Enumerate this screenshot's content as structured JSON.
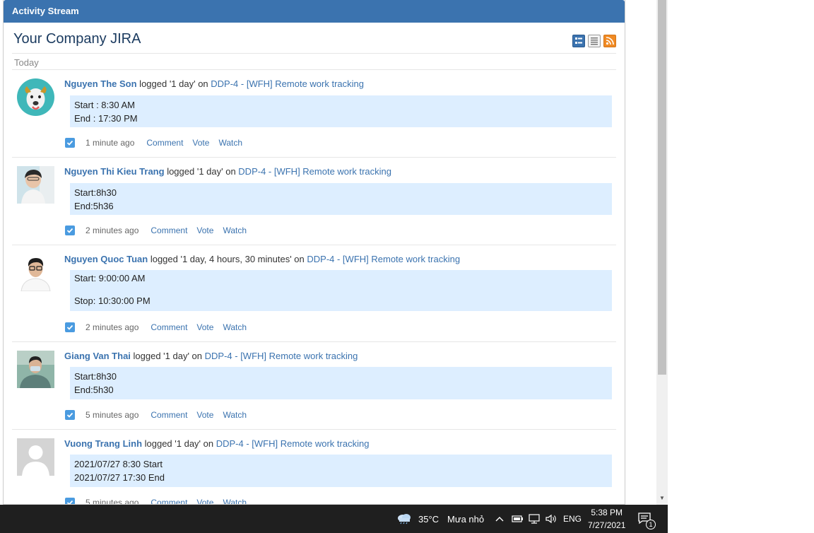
{
  "gadget": {
    "header": "Activity Stream",
    "title": "Your Company JIRA",
    "day_label": "Today"
  },
  "entries": [
    {
      "user": "Nguyen The Son",
      "action": " logged '1 day' on ",
      "issue": "DDP-4 - [WFH] Remote work tracking",
      "comment_lines": [
        "Start : 8:30 AM",
        "End : 17:30 PM"
      ],
      "ago": "1 minute ago"
    },
    {
      "user": "Nguyen Thi Kieu Trang",
      "action": " logged '1 day' on ",
      "issue": "DDP-4 - [WFH] Remote work tracking",
      "comment_lines": [
        "Start:8h30",
        "End:5h36"
      ],
      "ago": "2 minutes ago"
    },
    {
      "user": "Nguyen Quoc Tuan",
      "action": " logged '1 day, 4 hours, 30 minutes' on ",
      "issue": "DDP-4 - [WFH] Remote work tracking",
      "comment_lines": [
        "Start: 9:00:00 AM",
        "",
        "Stop: 10:30:00 PM"
      ],
      "ago": "2 minutes ago"
    },
    {
      "user": "Giang Van Thai",
      "action": " logged '1 day' on ",
      "issue": "DDP-4 - [WFH] Remote work tracking",
      "comment_lines": [
        "Start:8h30",
        "End:5h30"
      ],
      "ago": "5 minutes ago"
    },
    {
      "user": "Vuong Trang Linh",
      "action": " logged '1 day' on ",
      "issue": "DDP-4 - [WFH] Remote work tracking",
      "comment_lines": [
        "2021/07/27 8:30 Start",
        "2021/07/27 17:30 End"
      ],
      "ago": "5 minutes ago"
    }
  ],
  "actions": {
    "comment": "Comment",
    "vote": "Vote",
    "watch": "Watch"
  },
  "taskbar": {
    "weather_temp": "35°C",
    "weather_desc": "Mưa nhỏ",
    "language": "ENG",
    "time": "5:38 PM",
    "date": "7/27/2021",
    "notification_count": "1"
  },
  "colors": {
    "header_blue": "#3b73af",
    "comment_bg": "#ddeeff",
    "taskbar_bg": "#1f1f1f"
  }
}
